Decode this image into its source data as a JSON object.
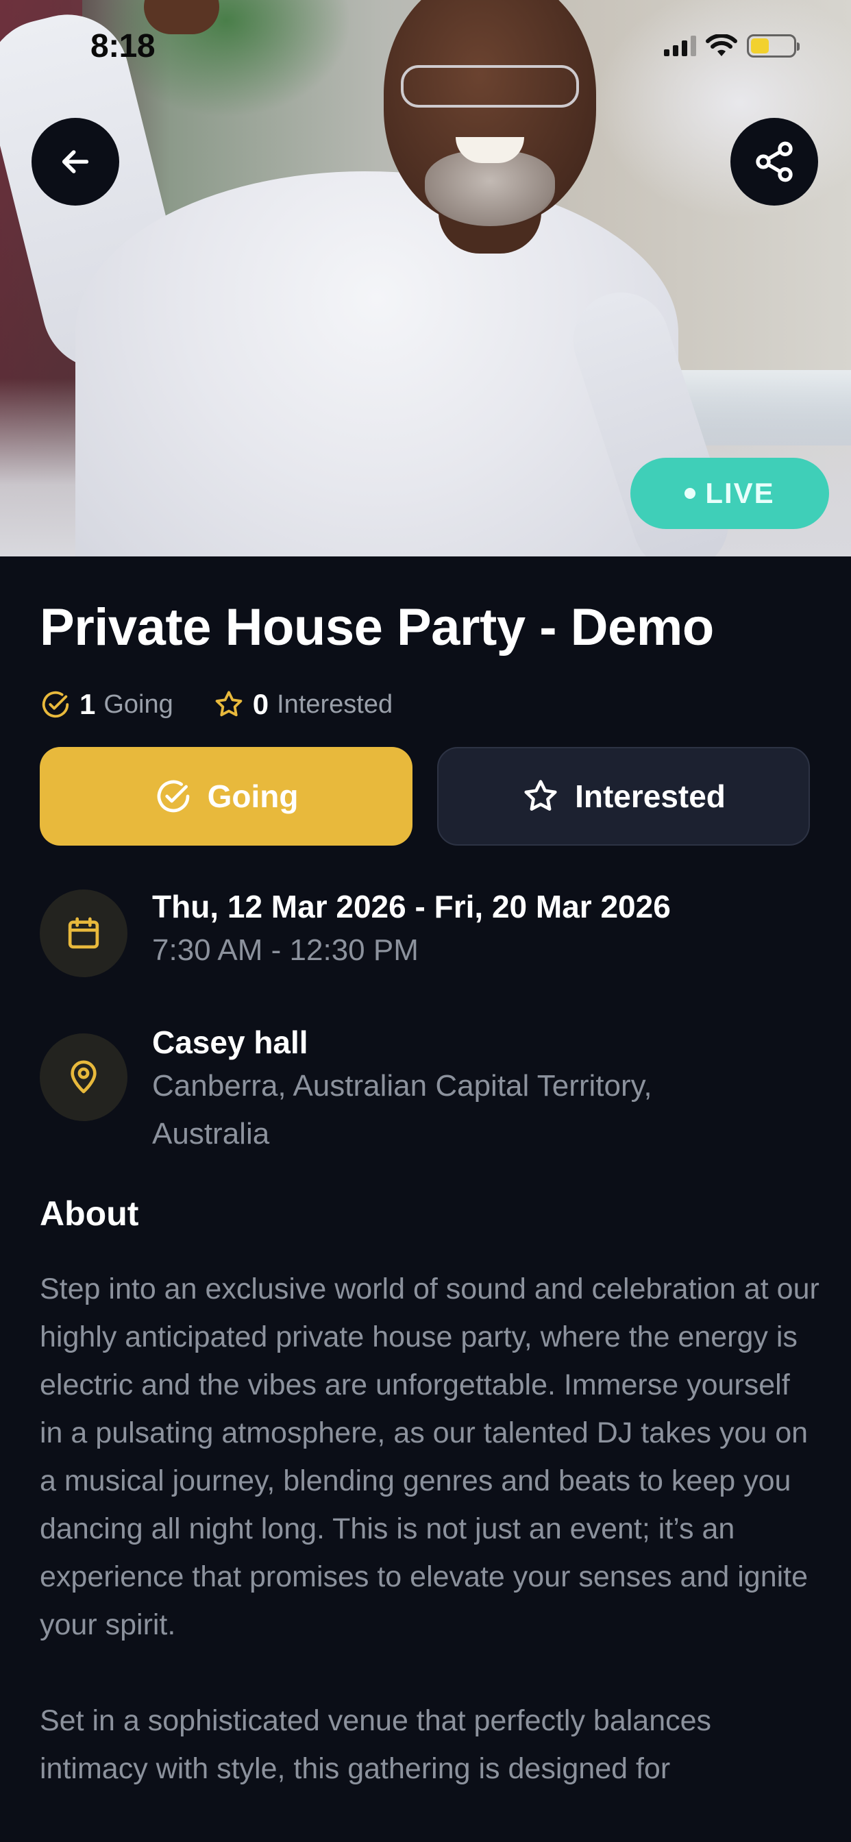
{
  "status_bar": {
    "time": "8:18"
  },
  "hero": {
    "live_label": "LIVE",
    "colors": {
      "live_badge": "#3fcfb8"
    }
  },
  "event": {
    "title": "Private House Party - Demo",
    "going_count": "1",
    "going_text": "Going",
    "interested_count": "0",
    "interested_text": "Interested"
  },
  "actions": {
    "going_label": "Going",
    "interested_label": "Interested",
    "colors": {
      "going_bg": "#e8b93c",
      "interested_bg": "#1c2130",
      "accent": "#e8b93c"
    }
  },
  "schedule": {
    "date_range": "Thu, 12 Mar 2026 - Fri, 20 Mar 2026",
    "time_range": "7:30 AM - 12:30 PM"
  },
  "location": {
    "venue": "Casey hall",
    "address": "Canberra, Australian Capital Territory, Australia"
  },
  "about": {
    "heading": "About",
    "paragraphs": [
      "Step into an exclusive world of sound and celebration at our highly anticipated private house party, where the energy is electric and the vibes are unforgettable. Immerse yourself in a pulsating atmosphere, as our talented DJ takes you on a musical journey, blending genres and beats to keep you dancing all night long. This is not just an event; it’s an experience that promises to elevate your senses and ignite your spirit.",
      "Set in a sophisticated venue that perfectly balances intimacy with style, this gathering is designed for"
    ]
  },
  "icons": {
    "back": "arrow-left-icon",
    "share": "share-icon",
    "going": "check-circle-icon",
    "interested": "star-icon",
    "calendar": "calendar-icon",
    "location": "map-pin-icon"
  }
}
